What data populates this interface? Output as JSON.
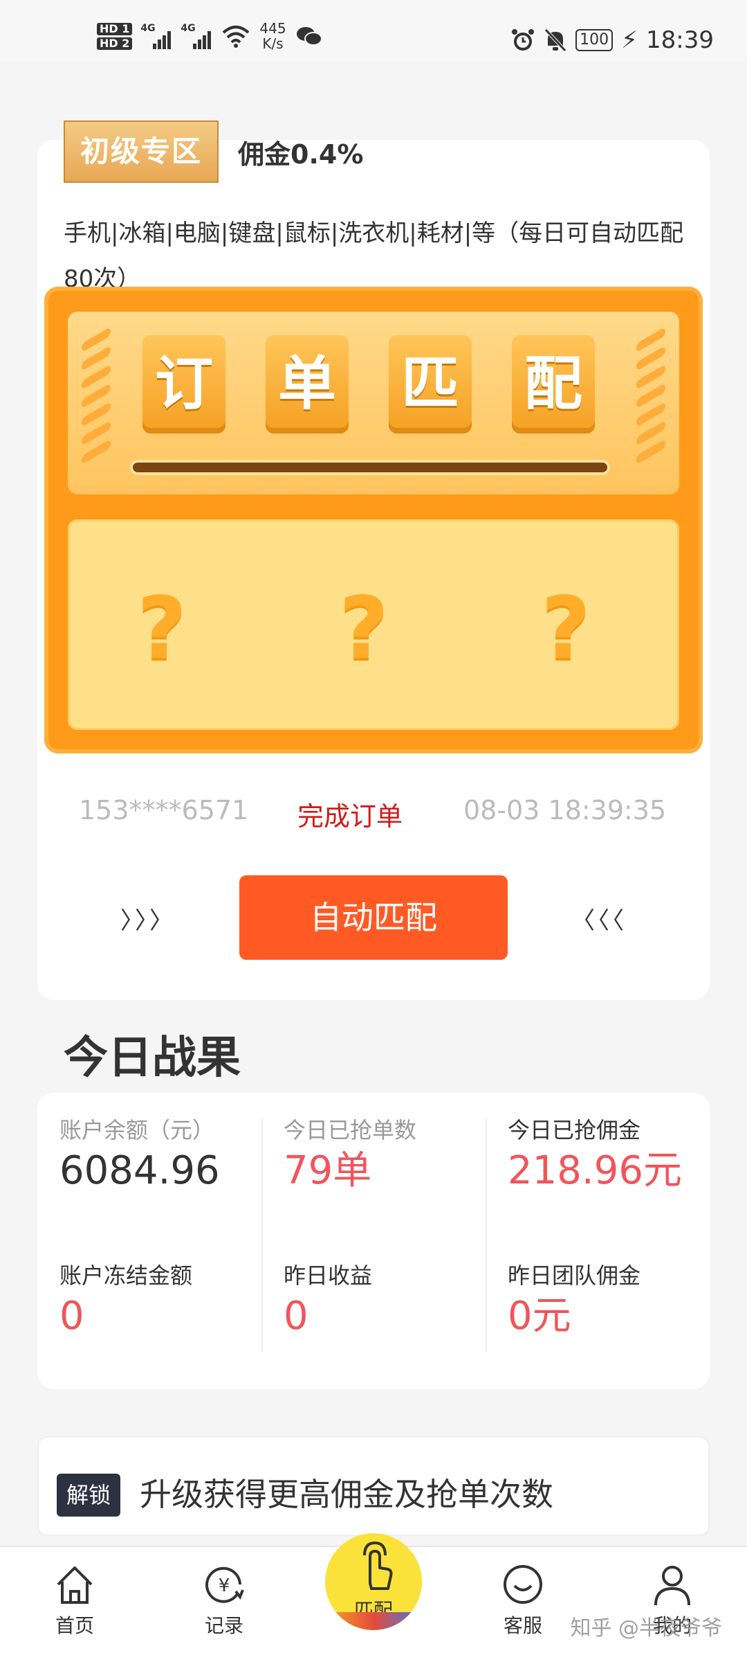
{
  "status_bar": {
    "hd1": "HD 1",
    "hd2": "HD 2",
    "net1": "4G",
    "net2": "4G",
    "speed_value": "445",
    "speed_unit": "K/s",
    "battery": "100",
    "time": "18:39"
  },
  "zone": {
    "badge": "初级专区",
    "commission": "佣金0.4%",
    "description": "手机|冰箱|电脑|键盘|鼠标|洗衣机|耗材|等（每日可自动匹配80次）"
  },
  "machine": {
    "tiles": [
      "订",
      "单",
      "匹",
      "配"
    ],
    "placeholders": [
      "?",
      "?",
      "?"
    ]
  },
  "ticker": {
    "phone": "153****6571",
    "status": "完成订单",
    "time": "08-03 18:39:35"
  },
  "action": {
    "left_arrows": "〉〉〉",
    "button": "自动匹配",
    "right_arrows": "〈〈〈"
  },
  "results": {
    "title": "今日战果",
    "items": [
      {
        "label": "账户余额（元）",
        "value": "6084.96"
      },
      {
        "label": "今日已抢单数",
        "value": "79单"
      },
      {
        "label": "今日已抢佣金",
        "value": "218.96元"
      },
      {
        "label": "账户冻结金额",
        "value": "0"
      },
      {
        "label": "昨日收益",
        "value": "0"
      },
      {
        "label": "昨日团队佣金",
        "value": "0元"
      }
    ]
  },
  "unlock": {
    "badge": "解锁",
    "text": "升级获得更高佣金及抢单次数"
  },
  "tabs": {
    "home": "首页",
    "records": "记录",
    "match": "匹配",
    "service": "客服",
    "mine": "我的"
  },
  "watermark": "知乎 @半夜爷爷",
  "colors": {
    "primary_button": "#ff5a24",
    "machine": "#ff9a1a",
    "value_red": "#f0555a",
    "status_red": "#d11a1a"
  }
}
